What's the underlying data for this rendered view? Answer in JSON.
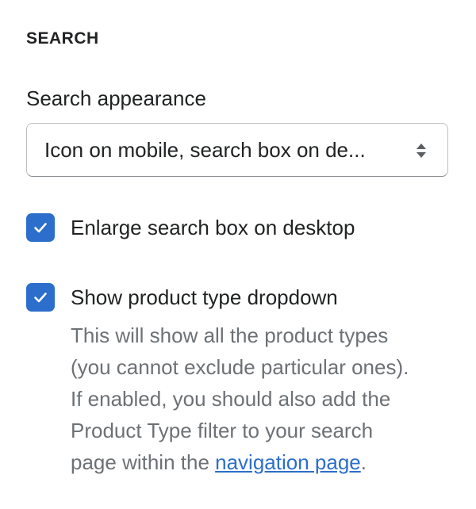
{
  "section": {
    "title": "SEARCH"
  },
  "search_appearance": {
    "label": "Search appearance",
    "selected_value": "Icon on mobile, search box on de...",
    "arrows_icon": "select-arrows-icon"
  },
  "enlarge_search": {
    "checked": true,
    "label": "Enlarge search box on desktop"
  },
  "product_type_dropdown": {
    "checked": true,
    "label": "Show product type dropdown",
    "help_lines": [
      "This will show all the product types",
      "(you cannot exclude particular ones).",
      "If enabled, you should also add the",
      "Product Type filter to your search"
    ],
    "help_last_prefix": "page within the ",
    "help_link": "navigation page",
    "help_last_suffix": "."
  },
  "colors": {
    "accent": "#2c6ecb",
    "text": "#202223",
    "subdued_text": "#6d7175",
    "border": "#babfc3"
  }
}
